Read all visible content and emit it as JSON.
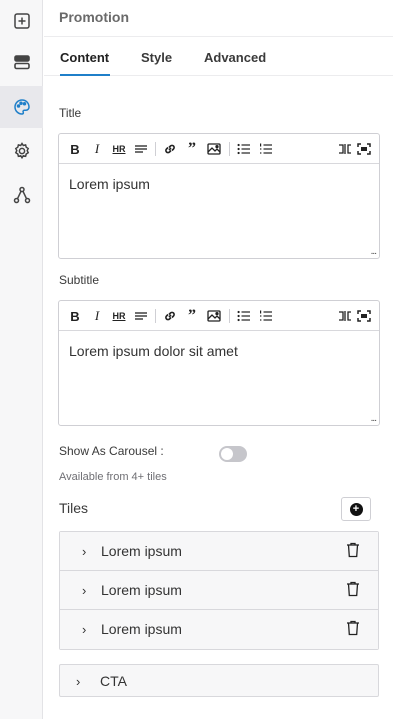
{
  "rail": {
    "items": [
      {
        "icon": "add-square-icon",
        "active": false
      },
      {
        "icon": "layout-rows-icon",
        "active": false
      },
      {
        "icon": "palette-icon",
        "active": true
      },
      {
        "icon": "gear-icon",
        "active": false
      },
      {
        "icon": "flow-branch-icon",
        "active": false
      }
    ]
  },
  "panel": {
    "title": "Promotion",
    "tabs": [
      {
        "label": "Content",
        "active": true
      },
      {
        "label": "Style",
        "active": false
      },
      {
        "label": "Advanced",
        "active": false
      }
    ]
  },
  "editor_toolbar": {
    "buttons": [
      "bold-icon",
      "italic-icon",
      "horizontal-rule-icon",
      "strikethrough-icon",
      "link-icon",
      "quote-icon",
      "image-icon",
      "bullet-list-icon",
      "numbered-list-icon",
      "split-view-icon",
      "fullscreen-icon"
    ],
    "bold_glyph": "B",
    "italic_glyph": "I",
    "hr_glyph": "HR"
  },
  "title_field": {
    "label": "Title",
    "value": "Lorem ipsum"
  },
  "subtitle_field": {
    "label": "Subtitle",
    "value": "Lorem ipsum dolor sit amet"
  },
  "carousel": {
    "label": "Show As Carousel :",
    "enabled": false,
    "hint": "Available from 4+ tiles"
  },
  "tiles": {
    "title": "Tiles",
    "add_icon": "add-circle-icon",
    "items": [
      {
        "label": "Lorem ipsum"
      },
      {
        "label": "Lorem ipsum"
      },
      {
        "label": "Lorem ipsum"
      }
    ]
  },
  "cta": {
    "label": "CTA"
  },
  "glyphs": {
    "chevron": "›",
    "dots": "...",
    "plus": "+"
  },
  "colors": {
    "accent": "#1f7fc9",
    "rail_bg": "#f7f7f8",
    "active_rail_bg": "#e8e8ec",
    "toggle_off": "#c6c6cb"
  }
}
